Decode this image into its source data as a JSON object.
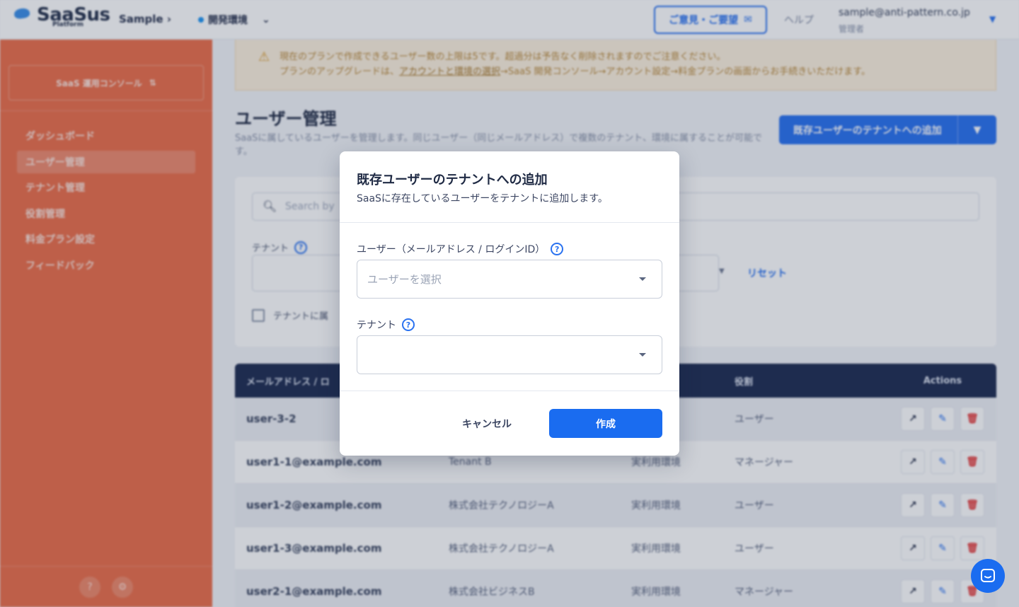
{
  "topbar": {
    "logo_text": "SaaSus",
    "logo_sub": "Platform",
    "app_name": "Sample",
    "environment": "開発環境",
    "feedback_label": "ご意見・ご要望",
    "help_label": "ヘルプ",
    "user_email": "sample@anti-pattern.co.jp",
    "user_role": "管理者"
  },
  "sidebar": {
    "console_label": "SaaS 運用コンソール",
    "items": [
      {
        "label": "ダッシュボード"
      },
      {
        "label": "ユーザー管理"
      },
      {
        "label": "テナント管理"
      },
      {
        "label": "役割管理"
      },
      {
        "label": "料金プラン設定"
      },
      {
        "label": "フィードバック"
      }
    ]
  },
  "alert": {
    "line1": "現在のプランで作成できるユーザー数の上限は5です。超過分は予告なく削除されますのでご注意ください。",
    "line2_prefix": "プランのアップグレードは、",
    "line2_link": "アカウントと環境の選択",
    "line2_suffix": "→SaaS 開発コンソール→アカウント設定→料金プランの画面からお手続きいただけます。"
  },
  "page": {
    "title": "ユーザー管理",
    "description": "SaaSに属しているユーザーを管理します。同じユーザー（同じメールアドレス）で複数のテナント、環境に属することが可能です。",
    "primary_action": "既存ユーザーのテナントへの追加"
  },
  "filters": {
    "search_placeholder": "Search by",
    "tenant_label": "テナント",
    "reset_label": "リセット",
    "checkbox_label": "テナントに属"
  },
  "table": {
    "headers": [
      "メールアドレス / ロ",
      "",
      "",
      "役割",
      "Actions"
    ],
    "rows": [
      {
        "email": "user-3-2",
        "tenant": "",
        "env": "",
        "role": "ユーザー"
      },
      {
        "email": "user1-1@example.com",
        "tenant": "Tenant B",
        "env": "実利用環境",
        "role": "マネージャー"
      },
      {
        "email": "user1-2@example.com",
        "tenant": "株式会社テクノロジーA",
        "env": "実利用環境",
        "role": "ユーザー"
      },
      {
        "email": "user1-3@example.com",
        "tenant": "株式会社テクノロジーA",
        "env": "実利用環境",
        "role": "ユーザー"
      },
      {
        "email": "user2-1@example.com",
        "tenant": "株式会社ビジネスB",
        "env": "実利用環境",
        "role": "マネージャー"
      }
    ]
  },
  "modal": {
    "title": "既存ユーザーのテナントへの追加",
    "subtitle": "SaaSに存在しているユーザーをテナントに追加します。",
    "user_field_label": "ユーザー（メールアドレス / ログインID）",
    "user_placeholder": "ユーザーを選択",
    "tenant_field_label": "テナント",
    "tenant_value": "",
    "cancel_label": "キャンセル",
    "create_label": "作成"
  },
  "icons": {
    "help": "question-circle-icon",
    "caret": "caret-down-icon",
    "chat": "chat-icon"
  },
  "colors": {
    "primary": "#1a6cf0",
    "sidebar": "#ec6f4b",
    "table_header": "#1f2d52",
    "danger": "#e64545"
  }
}
